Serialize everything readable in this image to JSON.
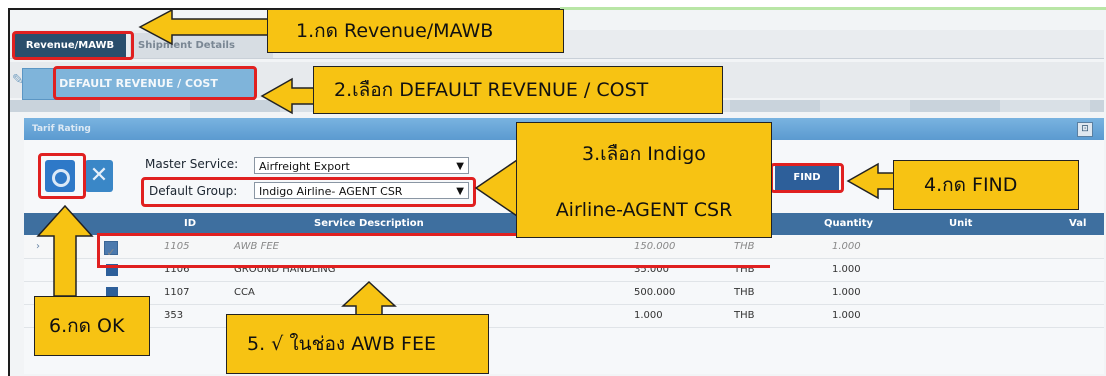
{
  "tabs": [
    {
      "label": "Revenue/MAWB"
    },
    {
      "label": "Shipment Details"
    }
  ],
  "toolbar": {
    "default_button": "DEFAULT REVENUE / COST"
  },
  "panel": {
    "title": "Tarif Rating",
    "maximize": "⊡"
  },
  "form": {
    "master_service_label": "Master Service:",
    "master_service_value": "Airfreight Export",
    "default_group_label": "Default Group:",
    "default_group_value": "Indigo Airline- AGENT CSR",
    "find_button": "FIND"
  },
  "table": {
    "headers": [
      "ID",
      "Service Description",
      "Quantity",
      "Unit",
      "Val"
    ],
    "rows": [
      {
        "id": "1105",
        "desc": "AWB FEE",
        "amount": "150.000",
        "curr": "THB",
        "qty": "1.000",
        "checked": true
      },
      {
        "id": "1106",
        "desc": "GROUND HANDLING",
        "amount": "35.000",
        "curr": "THB",
        "qty": "1.000",
        "checked": false
      },
      {
        "id": "1107",
        "desc": "CCA",
        "amount": "500.000",
        "curr": "THB",
        "qty": "1.000",
        "checked": false
      },
      {
        "id": "353",
        "desc": "",
        "amount": "1.000",
        "curr": "THB",
        "qty": "1.000",
        "checked": false
      }
    ]
  },
  "annotations": {
    "step1": "1.กด Revenue/MAWB",
    "step2": "2.เลือก DEFAULT REVENUE / COST",
    "step3_line1": "3.เลือก Indigo",
    "step3_line2": "Airline-AGENT CSR",
    "step4": "4.กด FIND",
    "step5": "5. √ ในช่อง AWB FEE",
    "step6": "6.กด OK"
  },
  "colors": {
    "callout": "#f7c313",
    "highlight": "#e02020",
    "header": "#3e6f9f"
  }
}
